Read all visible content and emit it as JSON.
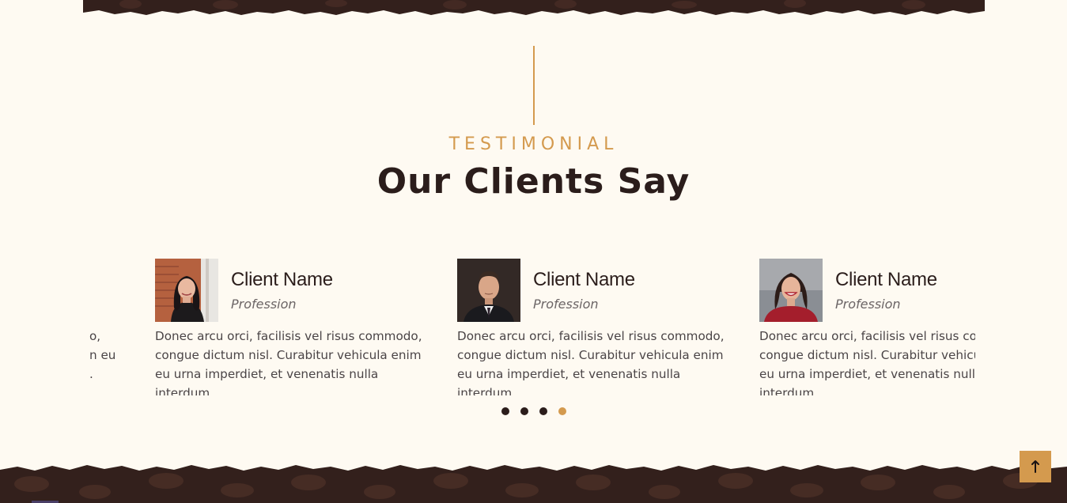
{
  "section": {
    "eyebrow": "TESTIMONIAL",
    "title": "Our Clients Say"
  },
  "testimonials": [
    {
      "name": "Client Name",
      "profession": "Profession",
      "quote": "Donec arcu orci, facilisis vel risus commodo, congue dictum nisl. Curabitur vehicula enim eu urna imperdiet, et venenatis nulla interdum."
    },
    {
      "name": "Client Name",
      "profession": "Profession",
      "quote": "Donec arcu orci, facilisis vel risus commodo, congue dictum nisl. Curabitur vehicula enim eu urna imperdiet, et venenatis nulla interdum."
    },
    {
      "name": "Client Name",
      "profession": "Profession",
      "quote": "Donec arcu orci, facilisis vel risus commodo, congue dictum nisl. Curabitur vehicula enim eu urna imperdiet, et venenatis nulla interdum."
    }
  ],
  "partial_card": {
    "line1": "o,",
    "line2": "n eu",
    "line3": "."
  },
  "carousel": {
    "dot_count": 4,
    "active_index": 3
  },
  "icons": {
    "back_to_top": "arrow-up-icon"
  },
  "colors": {
    "accent": "#d49a4e",
    "dark": "#2b1d1b",
    "background": "#fefaf2",
    "coffee": "#3a2420"
  }
}
